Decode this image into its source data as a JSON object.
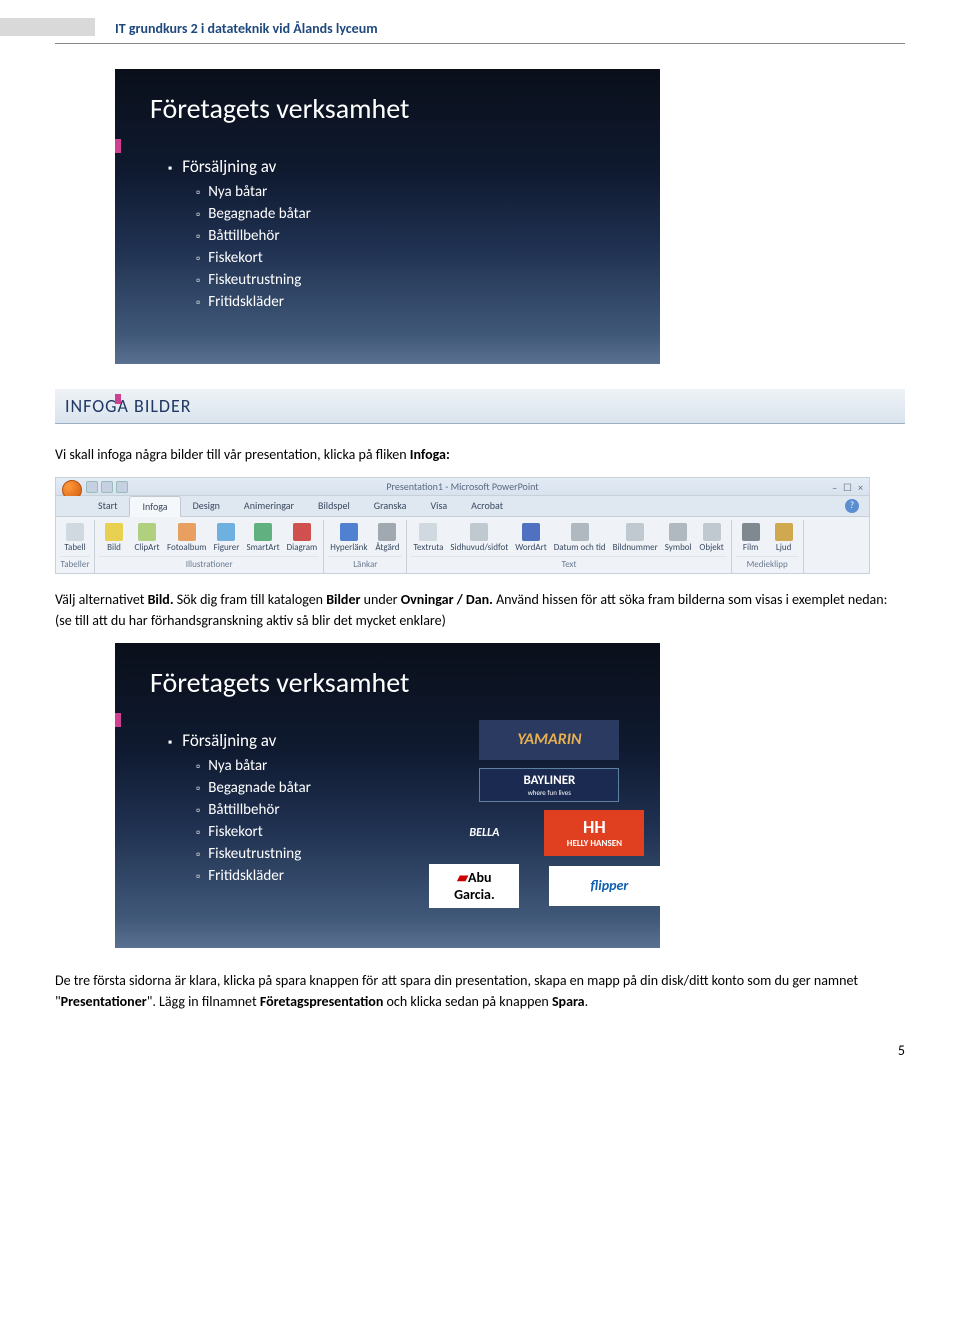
{
  "header": "IT grundkurs 2 i datateknik vid Ålands lyceum",
  "slide1": {
    "title": "Företagets verksamhet",
    "list_heading": "Försäljning av",
    "items": [
      "Nya båtar",
      "Begagnade båtar",
      "Båttillbehör",
      "Fiskekort",
      "Fiskeutrustning",
      "Fritidskläder"
    ]
  },
  "section_heading": "INFOGA BILDER",
  "intro": {
    "pre": "Vi skall infoga några bilder till vår presentation, klicka på fliken ",
    "b1": "Infoga:",
    "post": ""
  },
  "ribbon": {
    "title": "Presentation1 - Microsoft PowerPoint",
    "tabs": [
      "Start",
      "Infoga",
      "Design",
      "Animeringar",
      "Bildspel",
      "Granska",
      "Visa",
      "Acrobat"
    ],
    "groups": [
      {
        "label": "Tabeller",
        "items": [
          "Tabell"
        ]
      },
      {
        "label": "Illustrationer",
        "items": [
          "Bild",
          "ClipArt",
          "Fotoalbum",
          "Figurer",
          "SmartArt",
          "Diagram"
        ]
      },
      {
        "label": "Länkar",
        "items": [
          "Hyperlänk",
          "Åtgärd"
        ]
      },
      {
        "label": "Text",
        "items": [
          "Textruta",
          "Sidhuvud/sidfot",
          "WordArt",
          "Datum och tid",
          "Bildnummer",
          "Symbol",
          "Objekt"
        ]
      },
      {
        "label": "Medieklipp",
        "items": [
          "Film",
          "Ljud"
        ]
      }
    ]
  },
  "para2": {
    "t1": "Välj alternativet ",
    "b1": "Bild.",
    "t2": " Sök dig fram till katalogen ",
    "b2": "Bilder",
    "t3": " under ",
    "b3": "Ovningar / Dan.",
    "t4": " Använd hissen för att söka fram bilderna som visas i exemplet nedan: (se till att du har förhandsgranskning aktiv så blir det mycket enklare)"
  },
  "slide2": {
    "title": "Företagets verksamhet",
    "list_heading": "Försäljning av",
    "items": [
      "Nya båtar",
      "Begagnade båtar",
      "Båttillbehör",
      "Fiskekort",
      "Fiskeutrustning",
      "Fritidskläder"
    ],
    "logos": {
      "yamarin": "YAMARIN",
      "bayliner": "BAYLINER",
      "bayliner_sub": "where fun lives",
      "bella": "BELLA",
      "hh_top": "HH",
      "hh_bot": "HELLY HANSEN",
      "abu_top": "Abu",
      "abu_bot": "Garcia.",
      "flipper": "flipper"
    }
  },
  "para3": {
    "t1": "De tre första sidorna är klara, klicka på spara knappen för att spara din presentation, skapa en mapp på din disk/ditt konto som du ger namnet \"",
    "b1": "Presentationer",
    "t2": "\". Lägg in filnamnet ",
    "b2": "Företagspresentation",
    "t3": " och klicka sedan på knappen ",
    "b3": "Spara",
    "t4": "."
  },
  "page_number": "5",
  "icon_colors": {
    "Tabell": "#d0d8e0",
    "Bild": "#e8d050",
    "ClipArt": "#b0d080",
    "Fotoalbum": "#e8a060",
    "Figurer": "#70b0e0",
    "SmartArt": "#60b080",
    "Diagram": "#d05050",
    "Hyperlänk": "#5080d0",
    "Åtgärd": "#a0a8b0",
    "Textruta": "#d0d8e0",
    "Sidhuvud/sidfot": "#c0c8d0",
    "WordArt": "#5070c0",
    "Datum och tid": "#b0b8c0",
    "Bildnummer": "#c0c8d0",
    "Symbol": "#b0b8c0",
    "Objekt": "#c0c8d0",
    "Film": "#808890",
    "Ljud": "#d0a850"
  }
}
